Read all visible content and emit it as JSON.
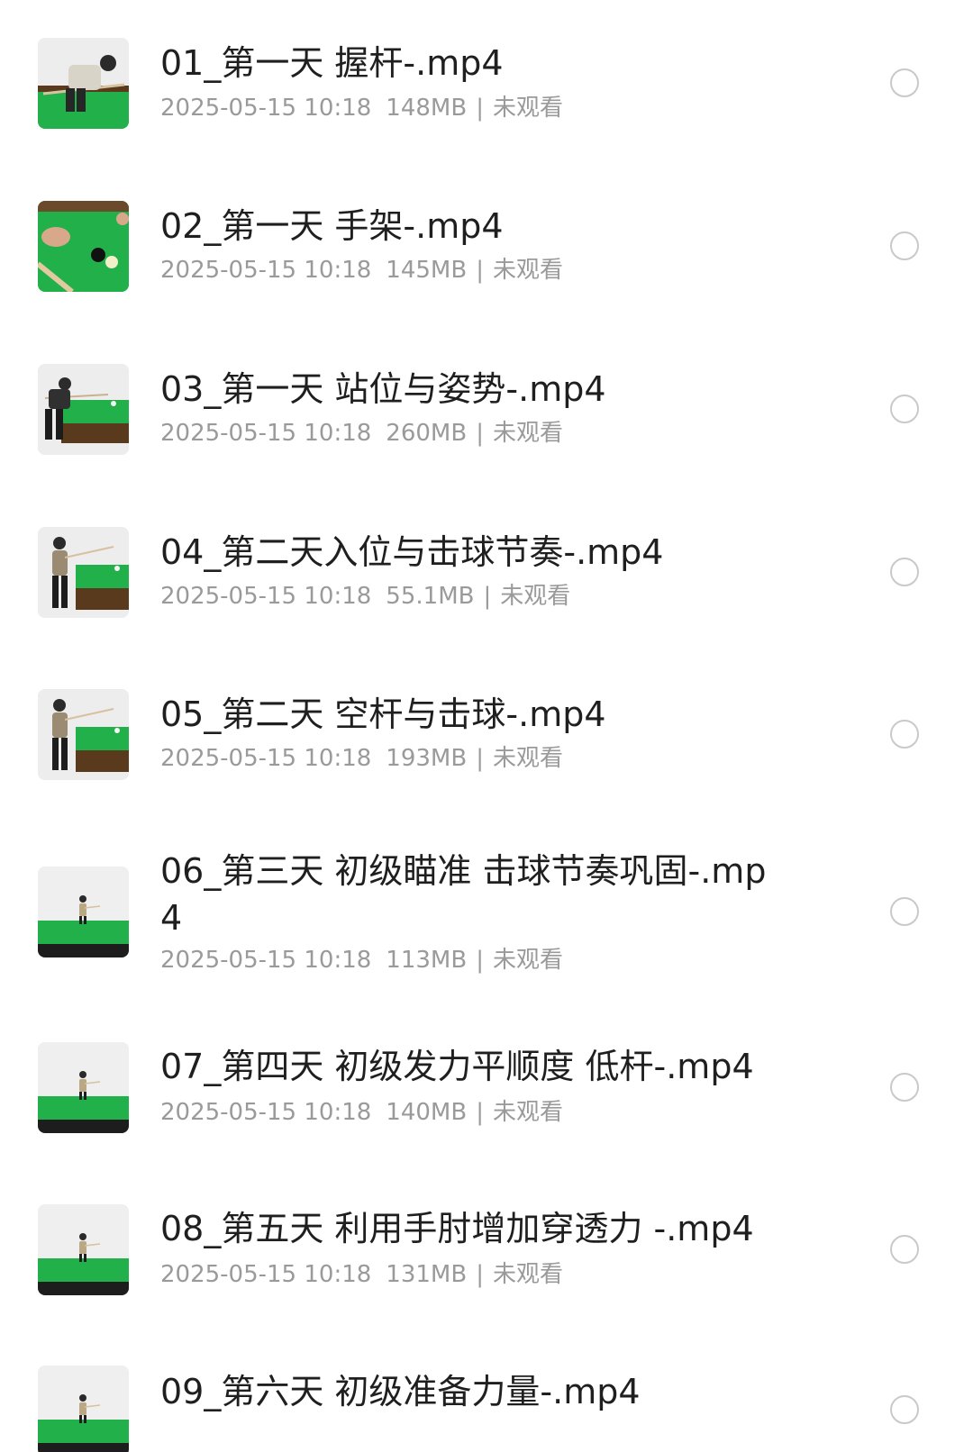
{
  "files": [
    {
      "name": "01_第一天 握杆-.mp4",
      "date": "2025-05-15 10:18",
      "size": "148MB",
      "status": "未观看",
      "thumb_scene": "grip",
      "thumbnail_icon": "billiards-video-thumbnail"
    },
    {
      "name": "02_第一天 手架-.mp4",
      "date": "2025-05-15 10:18",
      "size": "145MB",
      "status": "未观看",
      "thumb_scene": "bridge",
      "thumbnail_icon": "billiards-video-thumbnail"
    },
    {
      "name": "03_第一天 站位与姿势-.mp4",
      "date": "2025-05-15 10:18",
      "size": "260MB",
      "status": "未观看",
      "thumb_scene": "stance",
      "thumbnail_icon": "billiards-video-thumbnail"
    },
    {
      "name": "04_第二天入位与击球节奏-.mp4",
      "date": "2025-05-15 10:18",
      "size": "55.1MB",
      "status": "未观看",
      "thumb_scene": "standing",
      "thumbnail_icon": "billiards-video-thumbnail"
    },
    {
      "name": "05_第二天 空杆与击球-.mp4",
      "date": "2025-05-15 10:18",
      "size": "193MB",
      "status": "未观看",
      "thumb_scene": "standing",
      "thumbnail_icon": "billiards-video-thumbnail"
    },
    {
      "name": "06_第三天 初级瞄准 击球节奏巩固-.mp4",
      "date": "2025-05-15 10:18",
      "size": "113MB",
      "status": "未观看",
      "thumb_scene": "far",
      "thumbnail_icon": "billiards-video-thumbnail"
    },
    {
      "name": "07_第四天 初级发力平顺度 低杆-.mp4",
      "date": "2025-05-15 10:18",
      "size": "140MB",
      "status": "未观看",
      "thumb_scene": "far",
      "thumbnail_icon": "billiards-video-thumbnail"
    },
    {
      "name": "08_第五天 利用手肘增加穿透力 -.mp4",
      "date": "2025-05-15 10:18",
      "size": "131MB",
      "status": "未观看",
      "thumb_scene": "far",
      "thumbnail_icon": "billiards-video-thumbnail"
    },
    {
      "name": "09_第六天 初级准备力量-.mp4",
      "date": "",
      "size": "",
      "status": "",
      "thumb_scene": "far",
      "thumbnail_icon": "billiards-video-thumbnail"
    }
  ],
  "colors": {
    "title": "#1f1f1f",
    "meta": "#9a9a9a",
    "radio_border": "#c9c9c9",
    "table_green": "#22b04b"
  },
  "selection_icon": "radio-unchecked-icon"
}
